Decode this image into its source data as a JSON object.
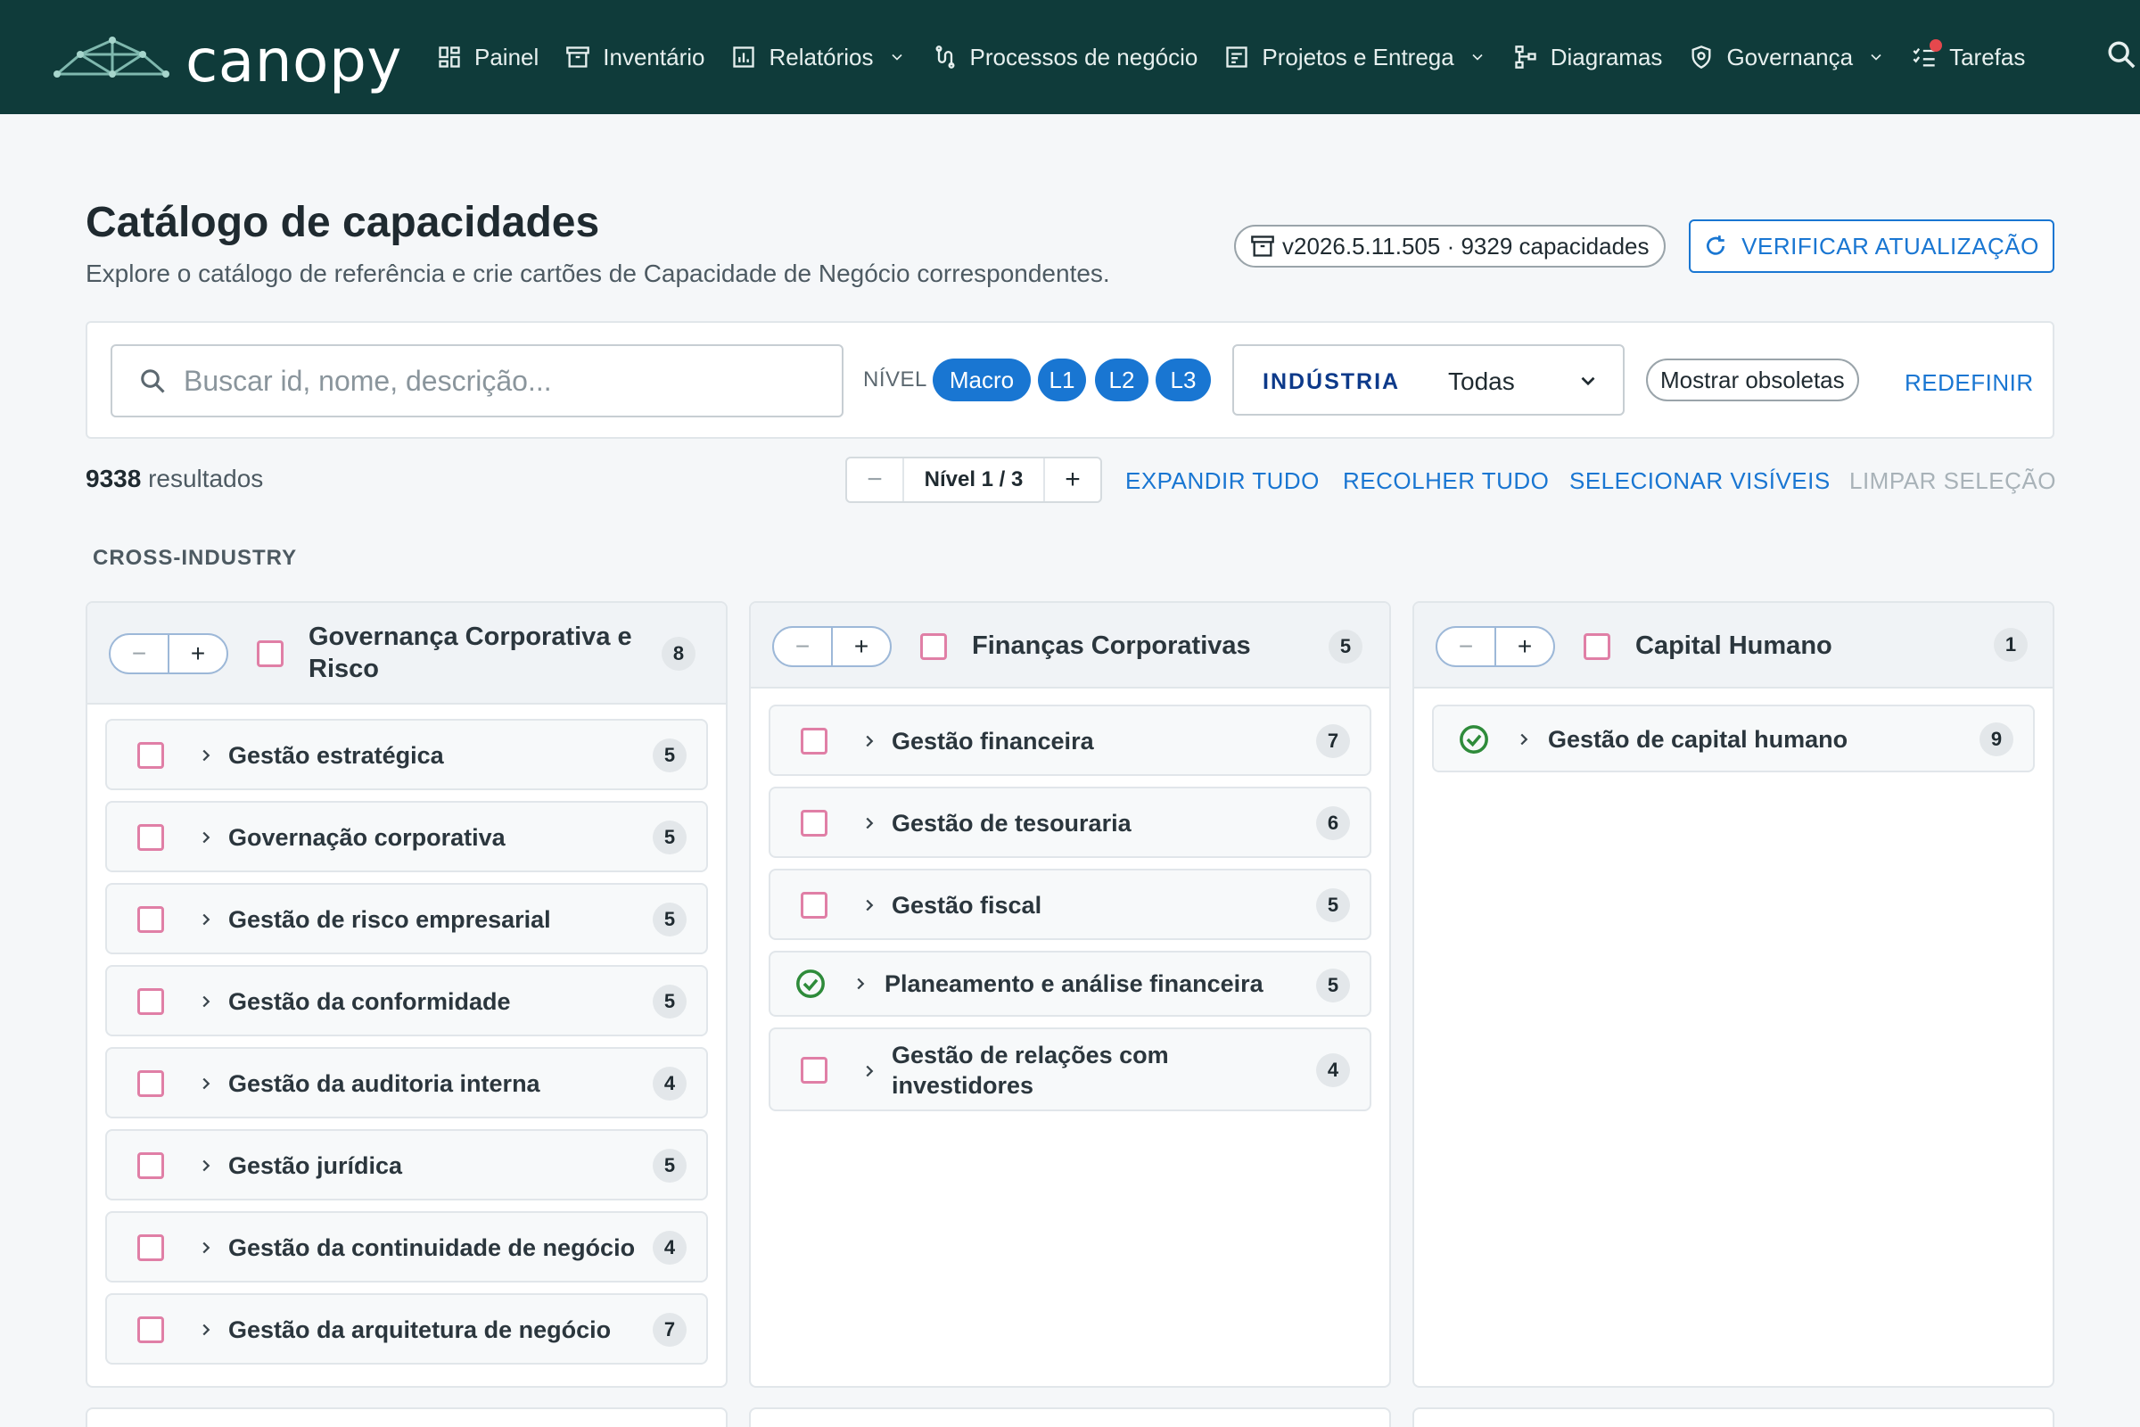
{
  "brand": {
    "name": "canopy"
  },
  "nav": [
    {
      "label": "Painel",
      "icon": "dashboard-icon"
    },
    {
      "label": "Inventário",
      "icon": "archive-icon"
    },
    {
      "label": "Relatórios",
      "icon": "chart-icon",
      "has_menu": true
    },
    {
      "label": "Processos de negócio",
      "icon": "process-icon"
    },
    {
      "label": "Projetos e Entrega",
      "icon": "project-icon",
      "has_menu": true
    },
    {
      "label": "Diagramas",
      "icon": "diagram-icon"
    },
    {
      "label": "Governança",
      "icon": "shield-icon",
      "has_menu": true
    },
    {
      "label": "Tarefas",
      "icon": "tasks-icon",
      "has_notification": true
    }
  ],
  "header": {
    "title": "Catálogo de capacidades",
    "subtitle": "Explore o catálogo de referência e crie cartões de Capacidade de Negócio correspondentes.",
    "version": "v2026.5.11.505 · 9329 capacidades",
    "check_update": "VERIFICAR ATUALIZAÇÃO"
  },
  "filters": {
    "search_placeholder": "Buscar id, nome, descrição...",
    "level_label": "NÍVEL",
    "levels": [
      "Macro",
      "L1",
      "L2",
      "L3"
    ],
    "industry_label": "INDÚSTRIA",
    "industry_value": "Todas",
    "show_obsolete": "Mostrar obsoletas",
    "reset": "REDEFINIR"
  },
  "results": {
    "count": "9338",
    "count_suffix": "resultados",
    "level_stepper": "Nível 1 / 3",
    "expand_all": "EXPANDIR TUDO",
    "collapse_all": "RECOLHER TUDO",
    "select_visible": "SELECIONAR VISÍVEIS",
    "clear_selection": "LIMPAR SELEÇÃO"
  },
  "section": "CROSS-INDUSTRY",
  "colors": {
    "nav_bg": "#0f3b3a",
    "accent": "#1976d2",
    "checkbox": "#e07fa6",
    "ok": "#2e8b3a"
  },
  "columns": [
    {
      "title_line1": "Governança Corporativa e",
      "title_line2": "Risco",
      "count": "8",
      "items": [
        {
          "label": "Gestão estratégica",
          "count": "5",
          "state": "unchecked"
        },
        {
          "label": "Governação corporativa",
          "count": "5",
          "state": "unchecked"
        },
        {
          "label": "Gestão de risco empresarial",
          "count": "5",
          "state": "unchecked"
        },
        {
          "label": "Gestão da conformidade",
          "count": "5",
          "state": "unchecked"
        },
        {
          "label": "Gestão da auditoria interna",
          "count": "4",
          "state": "unchecked"
        },
        {
          "label": "Gestão jurídica",
          "count": "5",
          "state": "unchecked"
        },
        {
          "label": "Gestão da continuidade de negócio",
          "count": "4",
          "state": "unchecked"
        },
        {
          "label": "Gestão da arquitetura de negócio",
          "count": "7",
          "state": "unchecked"
        }
      ]
    },
    {
      "title_line1": "Finanças Corporativas",
      "title_line2": "",
      "count": "5",
      "items": [
        {
          "label": "Gestão financeira",
          "count": "7",
          "state": "unchecked"
        },
        {
          "label": "Gestão de tesouraria",
          "count": "6",
          "state": "unchecked"
        },
        {
          "label": "Gestão fiscal",
          "count": "5",
          "state": "unchecked"
        },
        {
          "label": "Planeamento e análise financeira",
          "count": "5",
          "state": "existing"
        },
        {
          "label_line1": "Gestão de relações com",
          "label_line2": "investidores",
          "count": "4",
          "state": "unchecked"
        }
      ]
    },
    {
      "title_line1": "Capital Humano",
      "title_line2": "",
      "count": "1",
      "items": [
        {
          "label": "Gestão de capital humano",
          "count": "9",
          "state": "existing"
        }
      ]
    }
  ]
}
